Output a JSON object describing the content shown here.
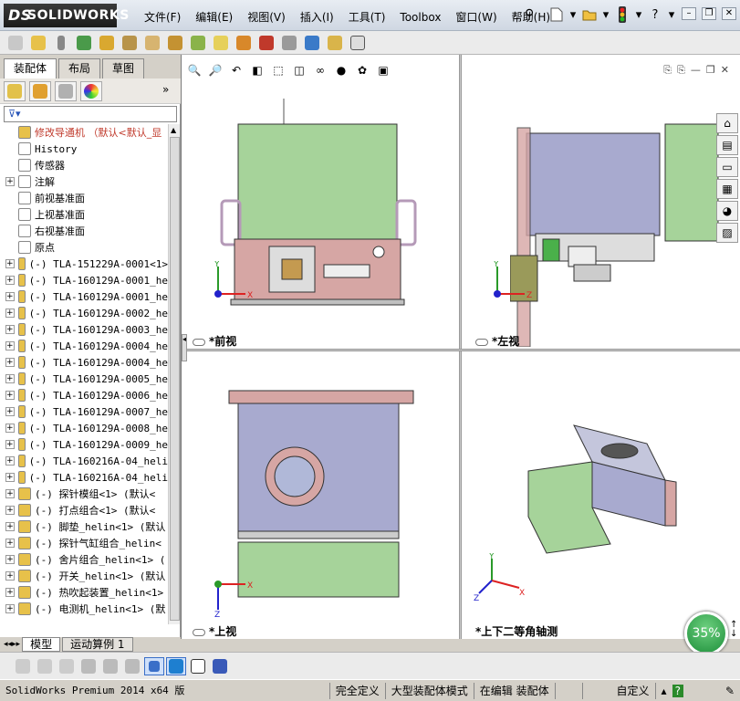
{
  "app": {
    "brand": "SOLIDWORKS",
    "brand_prefix": "DS"
  },
  "menu": [
    "文件(F)",
    "编辑(E)",
    "视图(V)",
    "插入(I)",
    "工具(T)",
    "Toolbox",
    "窗口(W)",
    "帮助(H)"
  ],
  "left_tabs": [
    "装配体",
    "布局",
    "草图"
  ],
  "tree": {
    "root": "修改导通机 （默认<默认_显",
    "items": [
      {
        "label": "History",
        "expandable": false
      },
      {
        "label": "传感器",
        "expandable": false
      },
      {
        "label": "注解",
        "expandable": true
      },
      {
        "label": "前视基准面",
        "expandable": false
      },
      {
        "label": "上视基准面",
        "expandable": false
      },
      {
        "label": "右视基准面",
        "expandable": false
      },
      {
        "label": "原点",
        "expandable": false
      },
      {
        "label": "(-) TLA-151229A-0001<1>",
        "expandable": true
      },
      {
        "label": "(-) TLA-160129A-0001_he",
        "expandable": true
      },
      {
        "label": "(-) TLA-160129A-0001_he",
        "expandable": true
      },
      {
        "label": "(-) TLA-160129A-0002_he",
        "expandable": true
      },
      {
        "label": "(-) TLA-160129A-0003_he",
        "expandable": true
      },
      {
        "label": "(-) TLA-160129A-0004_he",
        "expandable": true
      },
      {
        "label": "(-) TLA-160129A-0004_he",
        "expandable": true
      },
      {
        "label": "(-) TLA-160129A-0005_he",
        "expandable": true
      },
      {
        "label": "(-) TLA-160129A-0006_he",
        "expandable": true
      },
      {
        "label": "(-) TLA-160129A-0007_he",
        "expandable": true
      },
      {
        "label": "(-) TLA-160129A-0008_he",
        "expandable": true
      },
      {
        "label": "(-) TLA-160129A-0009_he",
        "expandable": true
      },
      {
        "label": "(-) TLA-160216A-04_heli",
        "expandable": true
      },
      {
        "label": "(-) TLA-160216A-04_heli",
        "expandable": true
      },
      {
        "label": "(-) 探针模组<1> (默认<",
        "expandable": true
      },
      {
        "label": "(-) 打点组合<1> (默认<",
        "expandable": true
      },
      {
        "label": "(-) 脚垫_helin<1> (默认",
        "expandable": true
      },
      {
        "label": "(-) 探针气缸组合_helin<",
        "expandable": true
      },
      {
        "label": "(-) 舍片组合_helin<1> (",
        "expandable": true
      },
      {
        "label": "(-) 开关_helin<1> (默认",
        "expandable": true
      },
      {
        "label": "(-) 热吹起装置_helin<1>",
        "expandable": true
      },
      {
        "label": "(-) 电测机_helin<1> (默",
        "expandable": true
      }
    ]
  },
  "bottom_tabs": [
    "模型",
    "运动算例 1"
  ],
  "views": {
    "front": "*前视",
    "left": "*左视",
    "top": "*上视",
    "iso": "*上下二等角轴测"
  },
  "zoom": "35%",
  "status": {
    "product": "SolidWorks Premium 2014 x64 版",
    "defined": "完全定义",
    "mode": "大型装配体模式",
    "editing": "在编辑 装配体",
    "units": "自定义"
  },
  "colors": {
    "green": "#a6d39a",
    "pink": "#d6a6a4",
    "blue": "#a8aacf",
    "accent": "#1d8f3a"
  }
}
